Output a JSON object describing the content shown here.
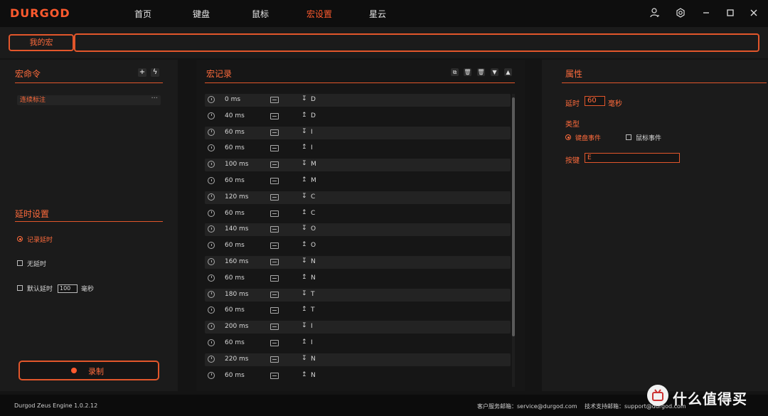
{
  "app": {
    "logo": "DURGOD",
    "nav": [
      "首页",
      "键盘",
      "鼠标",
      "宏设置",
      "星云"
    ],
    "active_nav": "宏设置",
    "window_icons": [
      "user-icon",
      "settings-icon",
      "minimize-icon",
      "maximize-icon",
      "close-icon"
    ]
  },
  "macro_tab": {
    "label": "我的宏",
    "name_value": ""
  },
  "left": {
    "title": "宏命令",
    "add_icon": "plus-icon",
    "lightning_icon": "lightning-icon",
    "items": [
      {
        "label": "连续标注",
        "more": "···"
      }
    ],
    "delay_title": "延时设置",
    "options": {
      "record_delay": "记录延时",
      "no_delay": "无延时",
      "default_delay": "默认延时",
      "default_delay_value": "100",
      "default_delay_unit": "毫秒"
    },
    "record_button": "录制"
  },
  "middle": {
    "title": "宏记录",
    "toolbar_icons": [
      "copy-icon",
      "delete-icon",
      "delete-all-icon",
      "move-down-icon",
      "move-up-icon"
    ],
    "rows": [
      {
        "ms": "0 ms",
        "arrow": "↧",
        "key": "D"
      },
      {
        "ms": "40 ms",
        "arrow": "↥",
        "key": "D"
      },
      {
        "ms": "60 ms",
        "arrow": "↧",
        "key": "I"
      },
      {
        "ms": "60 ms",
        "arrow": "↥",
        "key": "I"
      },
      {
        "ms": "100 ms",
        "arrow": "↧",
        "key": "M"
      },
      {
        "ms": "60 ms",
        "arrow": "↥",
        "key": "M"
      },
      {
        "ms": "120 ms",
        "arrow": "↧",
        "key": "C"
      },
      {
        "ms": "60 ms",
        "arrow": "↥",
        "key": "C"
      },
      {
        "ms": "140 ms",
        "arrow": "↧",
        "key": "O"
      },
      {
        "ms": "60 ms",
        "arrow": "↥",
        "key": "O"
      },
      {
        "ms": "160 ms",
        "arrow": "↧",
        "key": "N"
      },
      {
        "ms": "60 ms",
        "arrow": "↥",
        "key": "N"
      },
      {
        "ms": "180 ms",
        "arrow": "↧",
        "key": "T"
      },
      {
        "ms": "60 ms",
        "arrow": "↥",
        "key": "T"
      },
      {
        "ms": "200 ms",
        "arrow": "↧",
        "key": "I"
      },
      {
        "ms": "60 ms",
        "arrow": "↥",
        "key": "I"
      },
      {
        "ms": "220 ms",
        "arrow": "↧",
        "key": "N"
      },
      {
        "ms": "60 ms",
        "arrow": "↥",
        "key": "N"
      }
    ]
  },
  "right": {
    "title": "属性",
    "delay_label": "延时",
    "delay_value": "60",
    "delay_unit": "毫秒",
    "type_label": "类型",
    "type_keyboard": "键盘事件",
    "type_mouse": "鼠标事件",
    "key_label": "按键",
    "key_value": "E"
  },
  "footer": {
    "version": "Durgod Zeus Engine 1.0.2.12",
    "service_email": "客户服务邮箱：service@durgod.com",
    "support_email": "技术支持邮箱：support@durgod.com",
    "watermark": "什么值得买"
  },
  "colors": {
    "accent": "#ff5a2e",
    "background": "#141414",
    "panel": "#1b1b1b"
  }
}
